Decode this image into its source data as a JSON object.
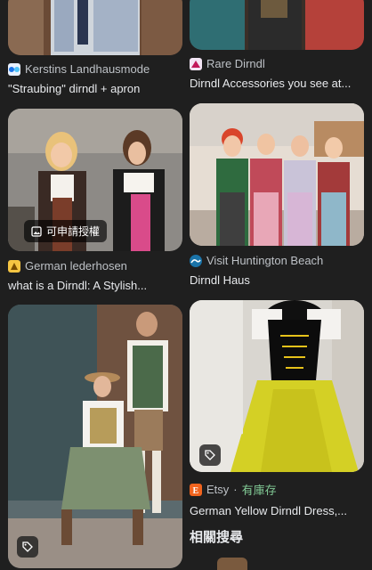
{
  "results": [
    {
      "source": "Kerstins Landhausmode",
      "title": "\"Straubing\" dirndl + apron",
      "icon": "kerstins-favicon"
    },
    {
      "source": "Rare Dirndl",
      "title": "Dirndl Accessories you see at...",
      "icon": "rare-dirndl-favicon"
    },
    {
      "source": "German lederhosen",
      "title": "what is a Dirndl: A Stylish...",
      "icon": "german-lederhosen-favicon",
      "badge": "可申請授權"
    },
    {
      "source": "Visit Huntington Beach",
      "title": "Dirndl Haus",
      "icon": "huntington-favicon"
    },
    {
      "source": "",
      "title": "",
      "icon": "tag-icon"
    },
    {
      "source": "Etsy",
      "stock": "有庫存",
      "title": "German Yellow Dirndl Dress,...",
      "icon": "etsy-favicon"
    }
  ],
  "related": {
    "title": "相關搜尋"
  }
}
